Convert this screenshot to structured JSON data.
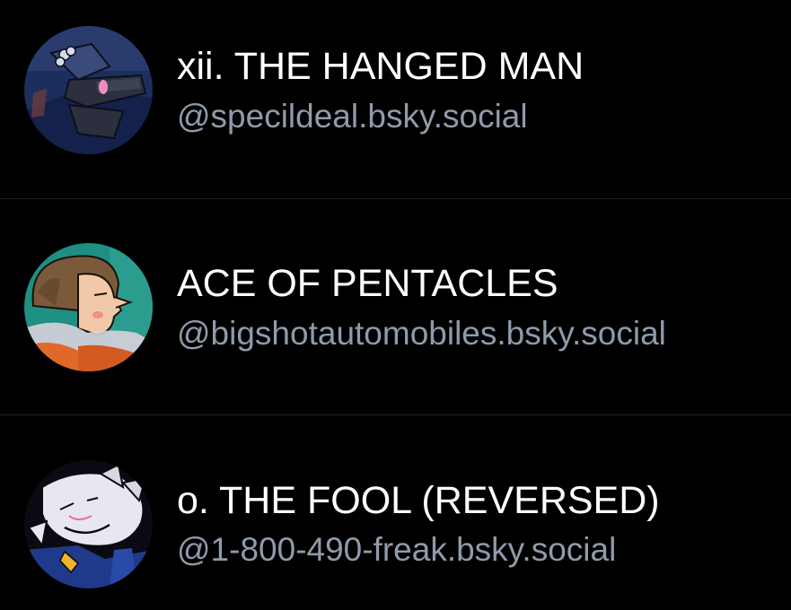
{
  "accounts": [
    {
      "display_name": "xii. THE HANGED MAN",
      "handle": "@specildeal.bsky.social",
      "avatar_icon": "avatar-hanged-man"
    },
    {
      "display_name": "ACE OF PENTACLES",
      "handle": "@bigshotautomobiles.bsky.social",
      "avatar_icon": "avatar-ace-of-pentacles"
    },
    {
      "display_name": "o. THE FOOL (REVERSED)",
      "handle": "@1-800-490-freak.bsky.social",
      "avatar_icon": "avatar-the-fool"
    }
  ],
  "colors": {
    "background": "#000000",
    "name_text": "#ffffff",
    "handle_text": "#8f9bab",
    "divider": "#1f242c"
  }
}
